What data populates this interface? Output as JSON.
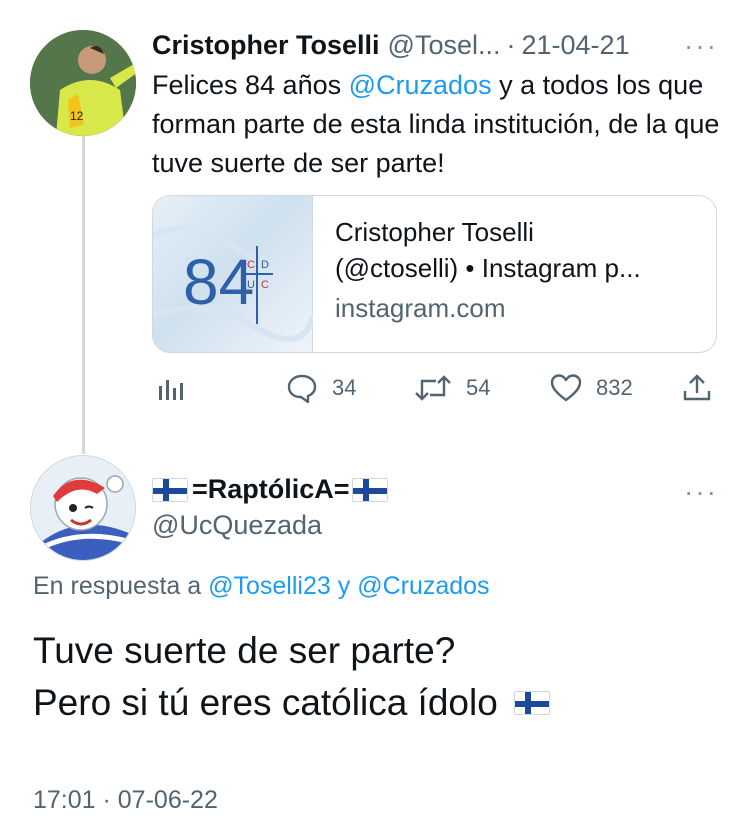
{
  "tweet1": {
    "author_name": "Cristopher Toselli",
    "handle": "@Tosel...",
    "separator": "·",
    "date": "21-04-21",
    "more": "···",
    "text_before": "Felices 84 años ",
    "text_mention": "@Cruzados",
    "text_after": " y a todos  los que forman parte de esta linda institución, de la que tuve suerte de ser parte!",
    "card": {
      "thumb_number": "84",
      "thumb_letters": [
        "C",
        "D",
        "U",
        "C"
      ],
      "title_line1": "Cristopher Toselli",
      "title_line2": "(@ctoselli) • Instagram p...",
      "domain": "instagram.com"
    },
    "actions": {
      "replies": "34",
      "retweets": "54",
      "likes": "832"
    }
  },
  "tweet2": {
    "author_name": "=RaptólicA=",
    "handle": "@UcQuezada",
    "more": "···",
    "reply_prefix": "En respuesta a ",
    "reply_mention1": "@Toselli23",
    "reply_conj": " y ",
    "reply_mention2": "@Cruzados",
    "text_line1": "Tuve suerte de ser parte?",
    "text_line2": "Pero si tú eres católica ídolo",
    "timestamp": "17:01 · 07-06-22"
  },
  "colors": {
    "link": "#1d9bf0",
    "secondary": "#536471",
    "border": "#cfd9de"
  },
  "icons": [
    "analytics-icon",
    "reply-icon",
    "retweet-icon",
    "like-icon",
    "share-icon",
    "more-icon",
    "finland-flag-icon"
  ]
}
